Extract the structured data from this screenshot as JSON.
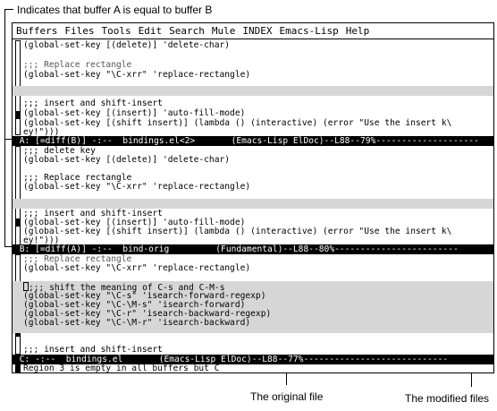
{
  "annotations": {
    "top": "Indicates that buffer A is equal to buffer B",
    "original": "The original file",
    "modified": "The modified files"
  },
  "menu": [
    "Buffers",
    "Files",
    "Tools",
    "Edit",
    "Search",
    "Mule",
    "INDEX",
    "Emacs-Lisp",
    "Help"
  ],
  "pane_a": {
    "lines": [
      "(global-set-key [(delete)] 'delete-char)",
      "",
      ";;; Replace rectangle",
      "(global-set-key \"\\C-xrr\" 'replace-rectangle)",
      "",
      "",
      "",
      ";;; insert and shift-insert",
      "(global-set-key [(insert)] 'auto-fill-mode)",
      "(global-set-key [(shift insert)] (lambda () (interactive) (error \"Use the insert k\\",
      "ey!\")))"
    ],
    "modeline": " A: [=diff(B)] -:--  bindings.el<2>       (Emacs-Lisp ElDoc)--L88--79%--------------------"
  },
  "pane_b": {
    "lines": [
      ";;; delete key",
      "(global-set-key [(delete)] 'delete-char)",
      "",
      ";;; Replace rectangle",
      "(global-set-key \"\\C-xrr\" 'replace-rectangle)",
      "",
      "",
      "",
      ";;; insert and shift-insert",
      "(global-set-key [(insert)] 'auto-fill-mode)",
      "(global-set-key [(shift insert)] (lambda () (interactive) (error \"Use the insert k\\",
      "ey!\")))"
    ],
    "modeline": " B: [=diff(A)] -:--  bind-orig         (Fundamental)--L88--80%------------------------"
  },
  "pane_c": {
    "lines": [
      ";;; Replace rectangle",
      "(global-set-key \"\\C-xrr\" 'replace-rectangle)",
      "",
      ";;; shift the meaning of C-s and C-M-s",
      "(global-set-key \"\\C-s\" 'isearch-forward-regexp)",
      "(global-set-key \"\\C-\\M-s\" 'isearch-forward)",
      "(global-set-key \"\\C-r\" 'isearch-backward-regexp)",
      "(global-set-key \"\\C-\\M-r\" 'isearch-backward)",
      "",
      "",
      "",
      ";;; insert and shift-insert"
    ],
    "modeline": " C: -:--  bindings.el       (Emacs-Lisp ElDoc)--L88--77%----------------------------"
  },
  "echo": "Region 3 is empty in all buffers but C"
}
